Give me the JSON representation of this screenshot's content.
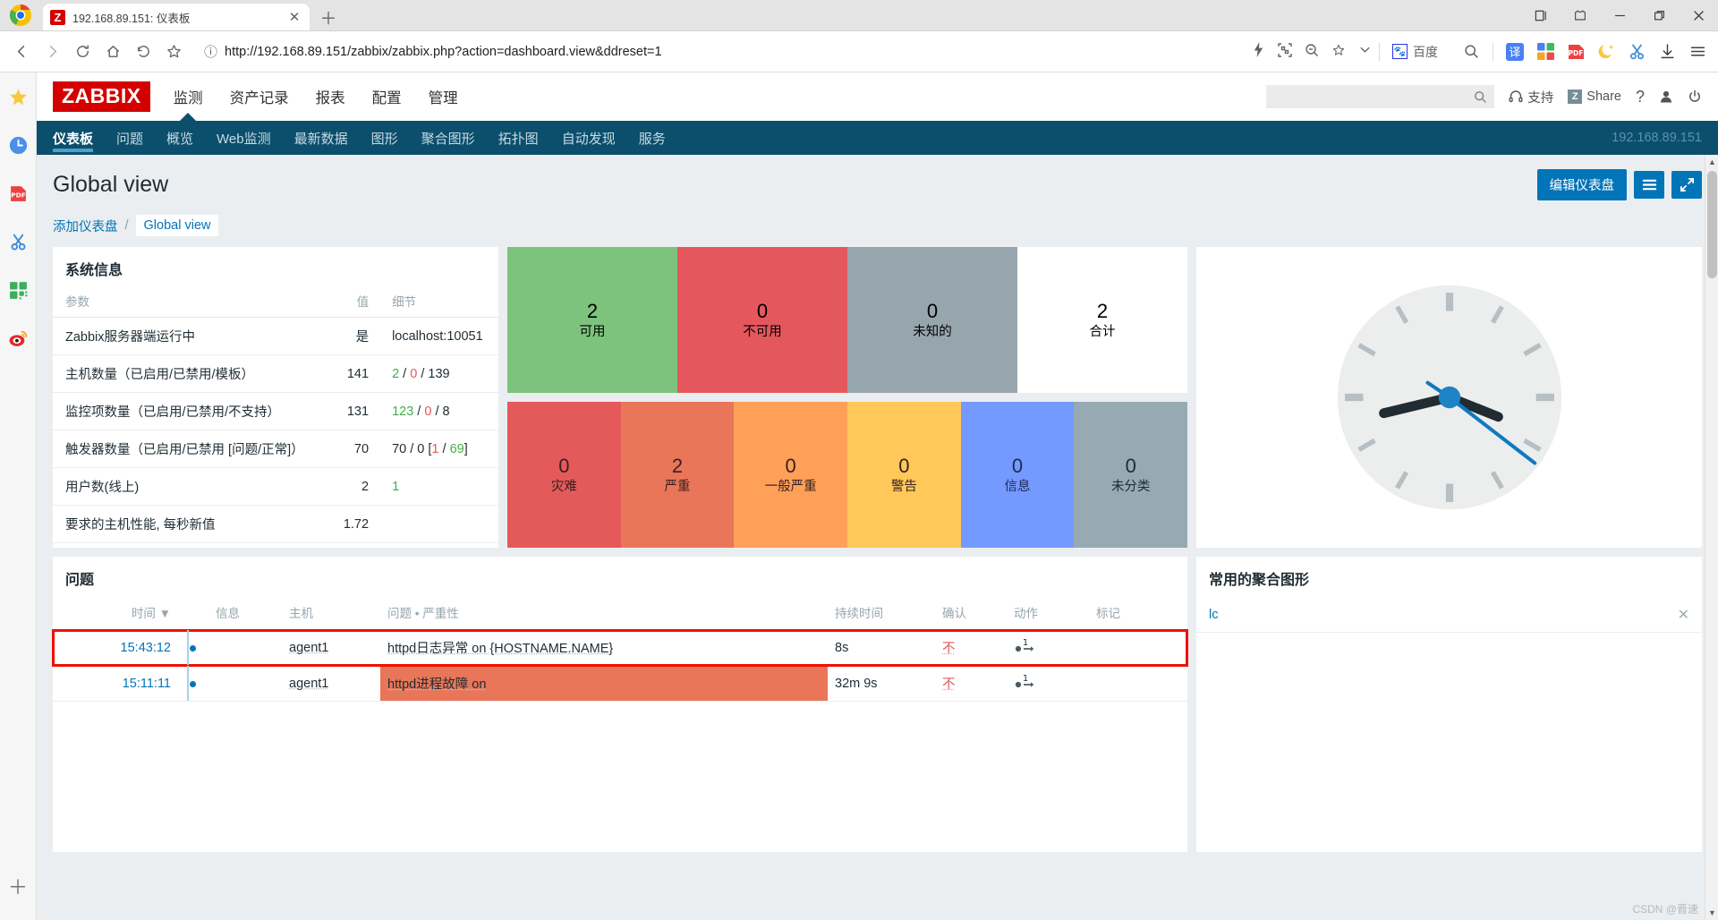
{
  "browser": {
    "tab": {
      "title": "192.168.89.151: 仪表板",
      "favicon_letter": "Z",
      "close_label": "✕"
    },
    "newtab_label": "＋",
    "window_controls": [
      "split-screen",
      "shirt",
      "—",
      "❐",
      "✕"
    ],
    "nav": {
      "back": "‹",
      "forward": "›",
      "reload": "⟳",
      "home": "⌂",
      "history": "↺",
      "bookmark": "☆"
    },
    "omnibox": {
      "security_icon": "ⓘ",
      "url": "http://192.168.89.151/zabbix/zabbix.php?action=dashboard.view&ddreset=1",
      "icons": [
        "lightning-icon",
        "qr-icon",
        "zoom-icon",
        "star-icon",
        "chevron-down-icon"
      ],
      "engine_label": "百度"
    },
    "toolbar_right": [
      "search-icon",
      "translate-icon",
      "apps-icon",
      "pdf-icon",
      "darkmode-icon",
      "scissors-icon",
      "download-icon",
      "menu-icon"
    ],
    "sidebar_icons": [
      "star-icon",
      "clock-icon",
      "pdf-icon",
      "scissors-icon",
      "grid-icon",
      "weibo-icon",
      "plus-icon"
    ]
  },
  "zabbix": {
    "logo": "ZABBIX",
    "main_menu": [
      {
        "label": "监测",
        "active": true
      },
      {
        "label": "资产记录",
        "active": false
      },
      {
        "label": "报表",
        "active": false
      },
      {
        "label": "配置",
        "active": false
      },
      {
        "label": "管理",
        "active": false
      }
    ],
    "search_placeholder": "",
    "header_right": [
      {
        "label": "支持",
        "icon": "headset-icon"
      },
      {
        "label": "Share",
        "icon": "share-badge"
      },
      {
        "label": "?",
        "icon": "help-icon"
      },
      {
        "label": "",
        "icon": "user-icon"
      },
      {
        "label": "",
        "icon": "power-icon"
      }
    ],
    "sub_nav": [
      {
        "label": "仪表板",
        "active": true
      },
      {
        "label": "问题",
        "active": false
      },
      {
        "label": "概览",
        "active": false
      },
      {
        "label": "Web监测",
        "active": false
      },
      {
        "label": "最新数据",
        "active": false
      },
      {
        "label": "图形",
        "active": false
      },
      {
        "label": "聚合图形",
        "active": false
      },
      {
        "label": "拓扑图",
        "active": false
      },
      {
        "label": "自动发现",
        "active": false
      },
      {
        "label": "服务",
        "active": false
      }
    ],
    "sub_nav_right": "192.168.89.151",
    "page_title": "Global view",
    "edit_dashboard_label": "编辑仪表盘",
    "breadcrumb": {
      "add_label": "添加仪表盘",
      "separator": "/",
      "current": "Global view"
    }
  },
  "system_info": {
    "title": "系统信息",
    "columns": [
      "参数",
      "值",
      "细节"
    ],
    "rows": [
      {
        "param": "Zabbix服务器端运行中",
        "value": "是",
        "value_color": "green",
        "detail": "localhost:10051",
        "detail_parts": []
      },
      {
        "param": "主机数量（已启用/已禁用/模板）",
        "value": "141",
        "value_color": "dark",
        "detail_parts": [
          {
            "t": "2",
            "c": "green"
          },
          {
            "t": " / ",
            "c": "dark"
          },
          {
            "t": "0",
            "c": "red"
          },
          {
            "t": " / ",
            "c": "dark"
          },
          {
            "t": "139",
            "c": "dark"
          }
        ]
      },
      {
        "param": "监控项数量（已启用/已禁用/不支持）",
        "value": "131",
        "value_color": "dark",
        "detail_parts": [
          {
            "t": "123",
            "c": "green"
          },
          {
            "t": " / ",
            "c": "dark"
          },
          {
            "t": "0",
            "c": "red"
          },
          {
            "t": " / ",
            "c": "dark"
          },
          {
            "t": "8",
            "c": "dark"
          }
        ]
      },
      {
        "param": "触发器数量（已启用/已禁用 [问题/正常]）",
        "value": "70",
        "value_color": "dark",
        "detail_parts": [
          {
            "t": "70 / 0 [",
            "c": "dark"
          },
          {
            "t": "1",
            "c": "red"
          },
          {
            "t": " / ",
            "c": "dark"
          },
          {
            "t": "69",
            "c": "green"
          },
          {
            "t": "]",
            "c": "dark"
          }
        ]
      },
      {
        "param": "用户数(线上)",
        "value": "2",
        "value_color": "dark",
        "detail_parts": [
          {
            "t": "1",
            "c": "green"
          }
        ]
      },
      {
        "param": "要求的主机性能, 每秒新值",
        "value": "1.72",
        "value_color": "dark",
        "detail_parts": []
      }
    ]
  },
  "host_availability": {
    "tiles": [
      {
        "num": "2",
        "label": "可用",
        "bg": "#7dc37d",
        "fg": "#1f2c33"
      },
      {
        "num": "0",
        "label": "不可用",
        "bg": "#e4575c",
        "fg": "#1f2c33"
      },
      {
        "num": "0",
        "label": "未知的",
        "bg": "#97a5ad",
        "fg": "#1f2c33"
      },
      {
        "num": "2",
        "label": "合计",
        "bg": "#ffffff",
        "fg": "#1f2c33"
      }
    ]
  },
  "problems_by_severity": {
    "tiles": [
      {
        "num": "0",
        "label": "灾难",
        "bg": "#e45959",
        "fg": "#3a2020"
      },
      {
        "num": "2",
        "label": "严重",
        "bg": "#e97659",
        "fg": "#3a2020"
      },
      {
        "num": "0",
        "label": "一般严重",
        "bg": "#ffa059",
        "fg": "#3a2020"
      },
      {
        "num": "0",
        "label": "警告",
        "bg": "#ffc859",
        "fg": "#3a2020"
      },
      {
        "num": "0",
        "label": "信息",
        "bg": "#7499ff",
        "fg": "#1d2a55"
      },
      {
        "num": "0",
        "label": "未分类",
        "bg": "#97aab3",
        "fg": "#1f2c33"
      }
    ]
  },
  "clock": {
    "hour": 3,
    "minute": 43,
    "second": 24
  },
  "problems": {
    "title": "问题",
    "columns": [
      "时间 ▼",
      "信息",
      "主机",
      "问题 • 严重性",
      "持续时间",
      "确认",
      "动作",
      "标记"
    ],
    "rows": [
      {
        "time": "15:43:12",
        "info": "",
        "host": "agent1",
        "problem": "httpd日志异常 on {HOSTNAME.NAME}",
        "duration": "8s",
        "ack": "不",
        "actions": "1",
        "tags": "",
        "severity_bg": "none",
        "highlighted": true
      },
      {
        "time": "15:11:11",
        "info": "",
        "host": "agent1",
        "problem": "httpd进程故障 on",
        "duration": "32m 9s",
        "ack": "不",
        "actions": "1",
        "tags": "",
        "severity_bg": "#e97659",
        "highlighted": false
      }
    ]
  },
  "favourite_graphs": {
    "title": "常用的聚合图形",
    "items": [
      {
        "name": "lc",
        "close": "✕"
      }
    ]
  },
  "watermark": "CSDN @晋速"
}
